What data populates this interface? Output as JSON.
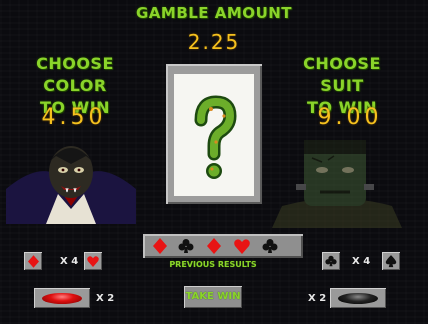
{
  "gamble": {
    "label": "GAMBLE AMOUNT",
    "amount": "2.25"
  },
  "color_panel": {
    "title_line1": "CHOOSE COLOR",
    "title_line2": "TO WIN",
    "amount": "4.50",
    "multiplier": "X 4",
    "pill_multiplier": "X 2",
    "pill_color": "red"
  },
  "suit_panel": {
    "title_line1": "CHOOSE SUIT",
    "title_line2": "TO WIN",
    "amount": "9.00",
    "multiplier": "X 4",
    "pill_multiplier": "X 2",
    "pill_color": "black"
  },
  "card": {
    "face": "?",
    "state": "hidden"
  },
  "previous_results": {
    "label": "PREVIOUS RESULTS",
    "cards": [
      "diamond",
      "club",
      "diamond",
      "heart",
      "club"
    ]
  },
  "take_win": {
    "label": "TAKE WIN"
  },
  "colors": {
    "slime_green": "#8ad42a",
    "amount_yellow": "#f5c11e",
    "red_suit": "#e81414",
    "black_suit": "#111111"
  }
}
